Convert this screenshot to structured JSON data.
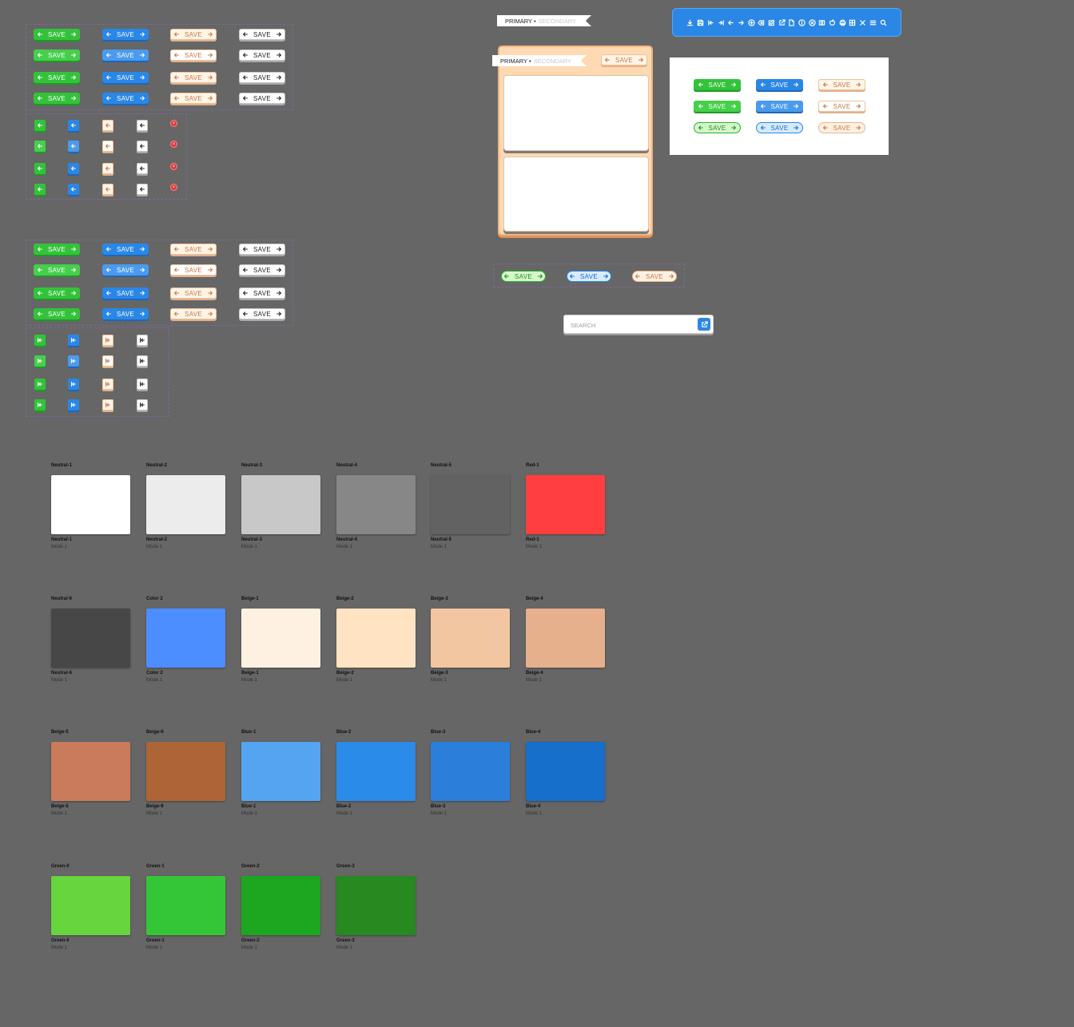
{
  "buttons": {
    "save_label": "SAVE",
    "variants": [
      "green",
      "blue",
      "beige",
      "white"
    ],
    "states": [
      "default",
      "hover",
      "pressed",
      "disabled"
    ]
  },
  "tags": {
    "primary": "PRIMARY •",
    "secondary": "SECONDARY"
  },
  "search": {
    "placeholder": "SEARCH"
  },
  "toolbar": {
    "icons": [
      "download-icon",
      "save-icon",
      "first-page-icon",
      "last-page-icon",
      "arrow-left-icon",
      "arrow-right-icon",
      "add-circle-icon",
      "backspace-icon",
      "edit-icon",
      "external-link-icon",
      "file-icon",
      "info-icon",
      "close-circle-icon",
      "columns-icon",
      "apple-icon",
      "print-icon",
      "grid-icon",
      "close-icon",
      "menu-icon",
      "search-icon"
    ]
  },
  "colors": {
    "green": "#33c33a",
    "blue": "#2a87e6",
    "beige": "#fff4e6",
    "red": "#e4323a",
    "background": "#666666"
  },
  "swatches": [
    {
      "name": "Neutral-1",
      "mode": "Mode 1",
      "color": "#ffffff"
    },
    {
      "name": "Neutral-2",
      "mode": "Mode 1",
      "color": "#ececec"
    },
    {
      "name": "Neutral-3",
      "mode": "Mode 1",
      "color": "#c8c8c8"
    },
    {
      "name": "Neutral-4",
      "mode": "Mode 1",
      "color": "#878787"
    },
    {
      "name": "Neutral-5",
      "mode": "Mode 1",
      "color": "#626262"
    },
    {
      "name": "Red-1",
      "mode": "Mode 1",
      "color": "#ff3f3f"
    },
    {
      "name": "Neutral-6",
      "mode": "Mode 1",
      "color": "#474747"
    },
    {
      "name": "Color 2",
      "mode": "Mode 1",
      "color": "#4c8dff"
    },
    {
      "name": "Beige-1",
      "mode": "Mode 1",
      "color": "#fff1e1"
    },
    {
      "name": "Beige-2",
      "mode": "Mode 1",
      "color": "#ffe3c2"
    },
    {
      "name": "Beige-3",
      "mode": "Mode 1",
      "color": "#f2c6a0"
    },
    {
      "name": "Beige-4",
      "mode": "Mode 1",
      "color": "#e5b08b"
    },
    {
      "name": "Beige-5",
      "mode": "Mode 1",
      "color": "#c97b5b"
    },
    {
      "name": "Beige-6",
      "mode": "Mode 1",
      "color": "#ad6437"
    },
    {
      "name": "Blue-1",
      "mode": "Mode 1",
      "color": "#55a4f2"
    },
    {
      "name": "Blue-2",
      "mode": "Mode 1",
      "color": "#2b8be9"
    },
    {
      "name": "Blue-3",
      "mode": "Mode 1",
      "color": "#2a7fda"
    },
    {
      "name": "Blue-4",
      "mode": "Mode 1",
      "color": "#156fcb"
    },
    {
      "name": "Green-0",
      "mode": "Mode 1",
      "color": "#67d53e"
    },
    {
      "name": "Green-1",
      "mode": "Mode 1",
      "color": "#35c638"
    },
    {
      "name": "Green-2",
      "mode": "Mode 1",
      "color": "#1da61f"
    },
    {
      "name": "Green-3",
      "mode": "Mode 1",
      "color": "#268a21"
    }
  ]
}
